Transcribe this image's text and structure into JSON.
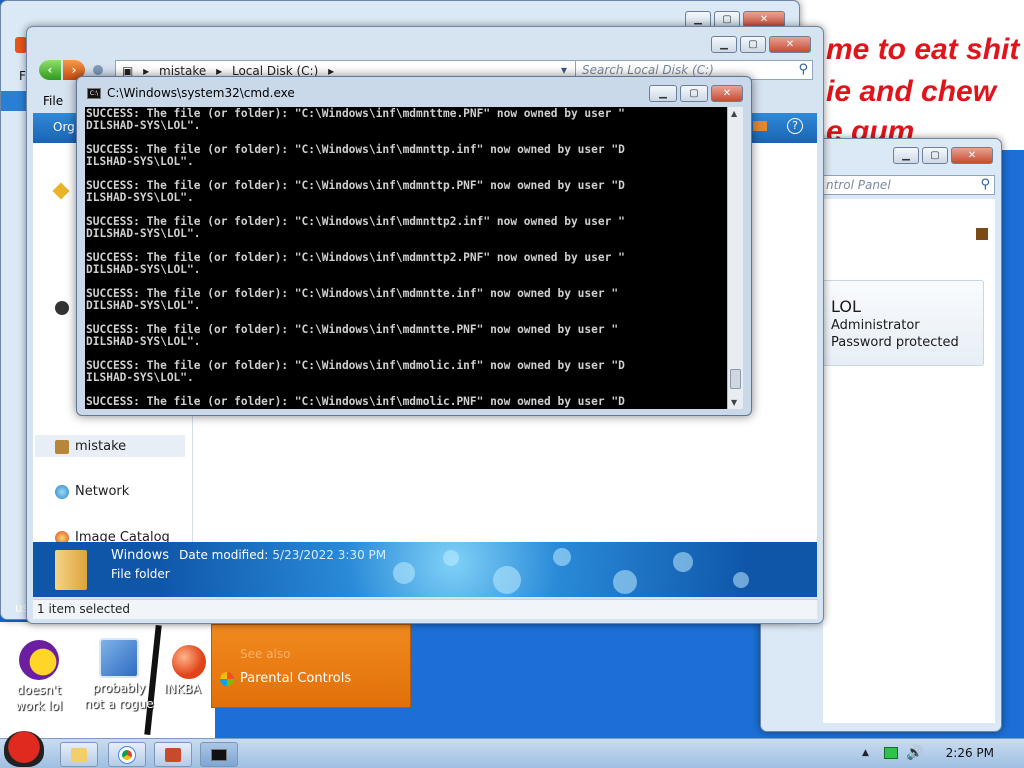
{
  "wallpaper": {
    "meme_lines": [
      "me to eat shit",
      "ie and chew",
      "e gum"
    ]
  },
  "desktop_icons": [
    {
      "label": "doesn't work lol",
      "name": "yahoo-messenger-icon"
    },
    {
      "label": "probably not a rogue",
      "name": "network-monitor-icon"
    },
    {
      "label": "INKBA",
      "name": "inkball-icon"
    }
  ],
  "control_panel": {
    "search_placeholder": "ntrol Panel",
    "user_name": "LOL",
    "user_role": "Administrator",
    "user_status": "Password protected",
    "see_also": "See also",
    "parental_controls": "Parental Controls"
  },
  "explorer": {
    "breadcrumb": [
      "mistake",
      "Local Disk (C:)"
    ],
    "search_placeholder": "Search Local Disk (C:)",
    "menu_file": "File",
    "toolbar_organize": "Org",
    "nav": {
      "mistake": "mistake",
      "network": "Network",
      "image_catalog": "Image Catalog"
    },
    "details": {
      "name": "Windows",
      "date_label": "Date modified:",
      "date_value": "5/23/2022 3:30 PM",
      "type": "File folder"
    },
    "status": "1 item selected",
    "left_edge_label": "us"
  },
  "partial_window": {
    "menu_label": "F"
  },
  "cmd": {
    "title": "C:\\Windows\\system32\\cmd.exe",
    "lines": [
      "SUCCESS: The file (or folder): \"C:\\Windows\\inf\\mdmnttme.PNF\" now owned by user \"",
      "DILSHAD-SYS\\LOL\".",
      "",
      "SUCCESS: The file (or folder): \"C:\\Windows\\inf\\mdmnttp.inf\" now owned by user \"D",
      "ILSHAD-SYS\\LOL\".",
      "",
      "SUCCESS: The file (or folder): \"C:\\Windows\\inf\\mdmnttp.PNF\" now owned by user \"D",
      "ILSHAD-SYS\\LOL\".",
      "",
      "SUCCESS: The file (or folder): \"C:\\Windows\\inf\\mdmnttp2.inf\" now owned by user \"",
      "DILSHAD-SYS\\LOL\".",
      "",
      "SUCCESS: The file (or folder): \"C:\\Windows\\inf\\mdmnttp2.PNF\" now owned by user \"",
      "DILSHAD-SYS\\LOL\".",
      "",
      "SUCCESS: The file (or folder): \"C:\\Windows\\inf\\mdmntte.inf\" now owned by user \"",
      "DILSHAD-SYS\\LOL\".",
      "",
      "SUCCESS: The file (or folder): \"C:\\Windows\\inf\\mdmntte.PNF\" now owned by user \"",
      "DILSHAD-SYS\\LOL\".",
      "",
      "SUCCESS: The file (or folder): \"C:\\Windows\\inf\\mdmolic.inf\" now owned by user \"D",
      "ILSHAD-SYS\\LOL\".",
      "",
      "SUCCESS: The file (or folder): \"C:\\Windows\\inf\\mdmolic.PNF\" now owned by user \"D"
    ]
  },
  "taskbar": {
    "clock": "2:26 PM"
  },
  "colors": {
    "desktop": "#1c6fd6",
    "meme_text": "#e0141a",
    "console_bg": "#000000",
    "console_text": "#cfcfcf",
    "orange_panel": "#ee8418"
  }
}
